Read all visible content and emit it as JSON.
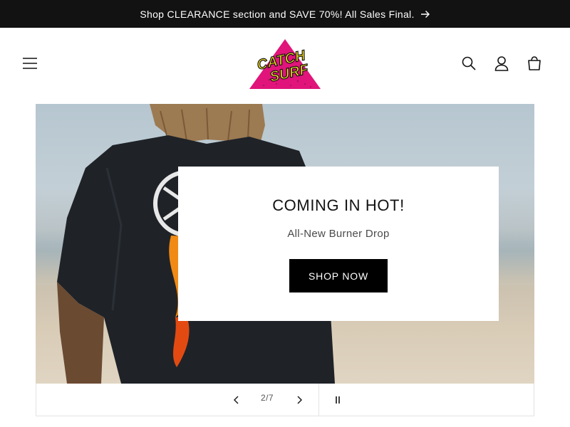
{
  "announcement": {
    "text": "Shop CLEARANCE section and SAVE 70%! All Sales Final.",
    "arrow_icon": "arrow-right-icon"
  },
  "header": {
    "menu_icon": "hamburger-menu-icon",
    "logo_text": "CATCH SURF",
    "icons": [
      "search-icon",
      "account-icon",
      "cart-icon"
    ]
  },
  "slide": {
    "heading": "COMING IN HOT!",
    "subheading": "All-New Burner Drop",
    "button_label": "SHOP NOW"
  },
  "slider_controls": {
    "counter": "2/7",
    "prev_icon": "chevron-left-icon",
    "next_icon": "chevron-right-icon",
    "pause_icon": "pause-icon"
  },
  "colors": {
    "announcement_bg": "#121212",
    "button_bg": "#000000",
    "logo_magenta": "#e0147a",
    "logo_yellow": "#f4e025"
  }
}
